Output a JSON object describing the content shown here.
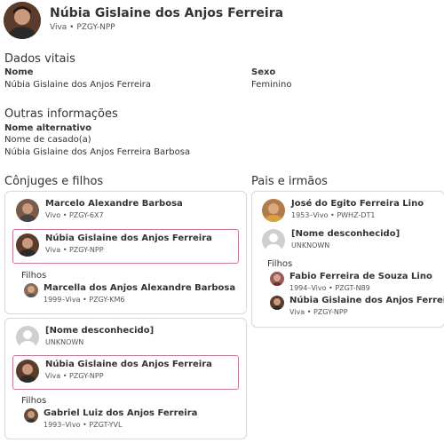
{
  "header": {
    "name": "Núbia Gislaine dos Anjos Ferreira",
    "meta": "Viva • PZGY-NPP"
  },
  "vital": {
    "heading": "Dados vitais",
    "name_label": "Nome",
    "name_value": "Núbia Gislaine dos Anjos Ferreira",
    "sex_label": "Sexo",
    "sex_value": "Feminino"
  },
  "other": {
    "heading": "Outras informações",
    "alt_label": "Nome alternativo",
    "alt_type": "Nome de casado(a)",
    "alt_value": "Núbia Gislaine dos Anjos Ferreira Barbosa"
  },
  "spouses": {
    "heading": "Cônjuges e filhos",
    "families": [
      {
        "spouse": {
          "name": "Marcelo Alexandre Barbosa",
          "meta": "Vivo • PZGY-6X7"
        },
        "self": {
          "name": "Núbia Gislaine dos Anjos Ferreira",
          "meta": "Viva • PZGY-NPP"
        },
        "children_label": "Filhos",
        "children": [
          {
            "name": "Marcella dos Anjos Alexandre Barbosa",
            "meta": "1999–Viva • PZGY-KM6"
          }
        ]
      },
      {
        "spouse": {
          "name": "[Nome desconhecido]",
          "meta": "UNKNOWN"
        },
        "self": {
          "name": "Núbia Gislaine dos Anjos Ferreira",
          "meta": "Viva • PZGY-NPP"
        },
        "children_label": "Filhos",
        "children": [
          {
            "name": "Gabriel Luiz dos Anjos Ferreira",
            "meta": "1993–Vivo • PZGT-YVL"
          }
        ]
      }
    ]
  },
  "parents": {
    "heading": "Pais e irmãos",
    "father": {
      "name": "José do Egito Ferreira Lino",
      "meta": "1953–Vivo • PWHZ-DT1"
    },
    "mother": {
      "name": "[Nome desconhecido]",
      "meta": "UNKNOWN"
    },
    "children_label": "Filhos",
    "children": [
      {
        "name": "Fabio Ferreira de Souza Lino",
        "meta": "1994–Vivo • PZGT-N89"
      },
      {
        "name": "Núbia Gislaine dos Anjos Ferreira",
        "meta": "Viva • PZGY-NPP"
      }
    ]
  },
  "colors": {
    "highlight_border": "#c9789a",
    "card_border": "#d9d9d9"
  }
}
